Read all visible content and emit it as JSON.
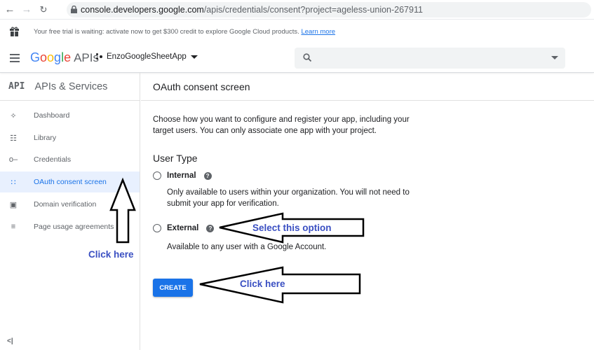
{
  "browser": {
    "url_host": "console.developers.google.com",
    "url_path": "/apis/credentials/consent?project=ageless-union-267911"
  },
  "banner": {
    "text": "Your free trial is waiting: activate now to get $300 credit to explore Google Cloud products.",
    "link": "Learn more"
  },
  "header": {
    "logo_letters": [
      "G",
      "o",
      "o",
      "g",
      "l",
      "e"
    ],
    "product": "APIs",
    "project_name": "EnzoGoogleSheetApp"
  },
  "sidebar": {
    "badge": "API",
    "title": "APIs & Services",
    "items": [
      {
        "label": "Dashboard",
        "icon": "dashboard-icon"
      },
      {
        "label": "Library",
        "icon": "library-icon"
      },
      {
        "label": "Credentials",
        "icon": "key-icon"
      },
      {
        "label": "OAuth consent screen",
        "icon": "consent-icon"
      },
      {
        "label": "Domain verification",
        "icon": "domain-icon"
      },
      {
        "label": "Page usage agreements",
        "icon": "settings-list-icon"
      }
    ],
    "collapse_label": "<|"
  },
  "main": {
    "title": "OAuth consent screen",
    "intro": "Choose how you want to configure and register your app, including your target users. You can only associate one app with your project.",
    "user_type_heading": "User Type",
    "internal_label": "Internal",
    "internal_desc": "Only available to users within your organization. You will not need to submit your app for verification.",
    "external_label": "External",
    "external_desc": "Available to any user with a Google Account.",
    "create_label": "CREATE"
  },
  "annotations": {
    "select_option": "Select this option",
    "click_here_sidebar": "Click here",
    "click_here_create": "Click here"
  },
  "colors": {
    "accent": "#1a73e8",
    "annotation_text": "#3a4fc2"
  }
}
